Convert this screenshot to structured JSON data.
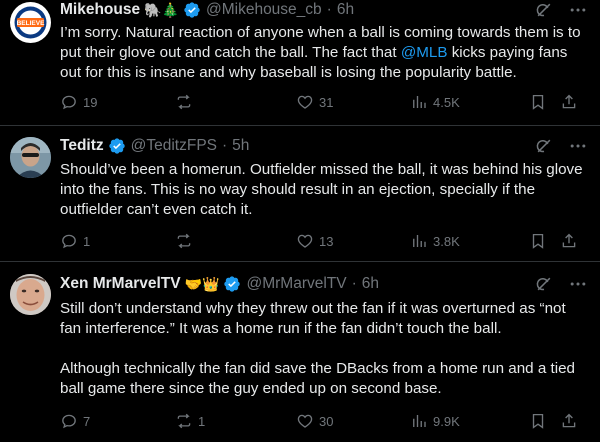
{
  "tweets": [
    {
      "name": "Mikehouse",
      "emojis": "🐘🎄",
      "handle": "@Mikehouse_cb",
      "separator": "·",
      "time": "6h",
      "text_before": "I’m sorry. Natural reaction of anyone when a ball is coming towards them is to put their glove out and catch the ball. The fact that ",
      "mention": "@MLB",
      "text_after": " kicks paying fans out for this is insane and why baseball is losing the popularity battle.",
      "replies": "19",
      "reposts": "",
      "likes": "31",
      "views": "4.5K",
      "avatar_label": "BELIEVE"
    },
    {
      "name": "Teditz",
      "emojis": "",
      "handle": "@TeditzFPS",
      "separator": "·",
      "time": "5h",
      "text": "Should’ve been a homerun. Outfielder missed the ball, it was behind his glove into the fans. This is no way should result in an ejection, specially if the outfielder can’t even catch it.",
      "replies": "1",
      "reposts": "",
      "likes": "13",
      "views": "3.8K"
    },
    {
      "name": "Xen MrMarvelTV",
      "emojis": "🤝👑",
      "handle": "@MrMarvelTV",
      "separator": "·",
      "time": "6h",
      "text": "Still don’t understand why they threw out the fan if it was overturned as “not fan interference.” It was a home run if the fan didn’t touch the ball.\n\nAlthough technically the fan did save the DBacks from a home run and a tied ball game there since the guy ended up on second base.",
      "replies": "7",
      "reposts": "1",
      "likes": "30",
      "views": "9.9K"
    }
  ],
  "colors": {
    "background": "#000000",
    "text": "#e7e9ea",
    "muted": "#71767b",
    "accent": "#1d9bf0",
    "divider": "#2f3336",
    "gold_check": "#e2b719"
  }
}
